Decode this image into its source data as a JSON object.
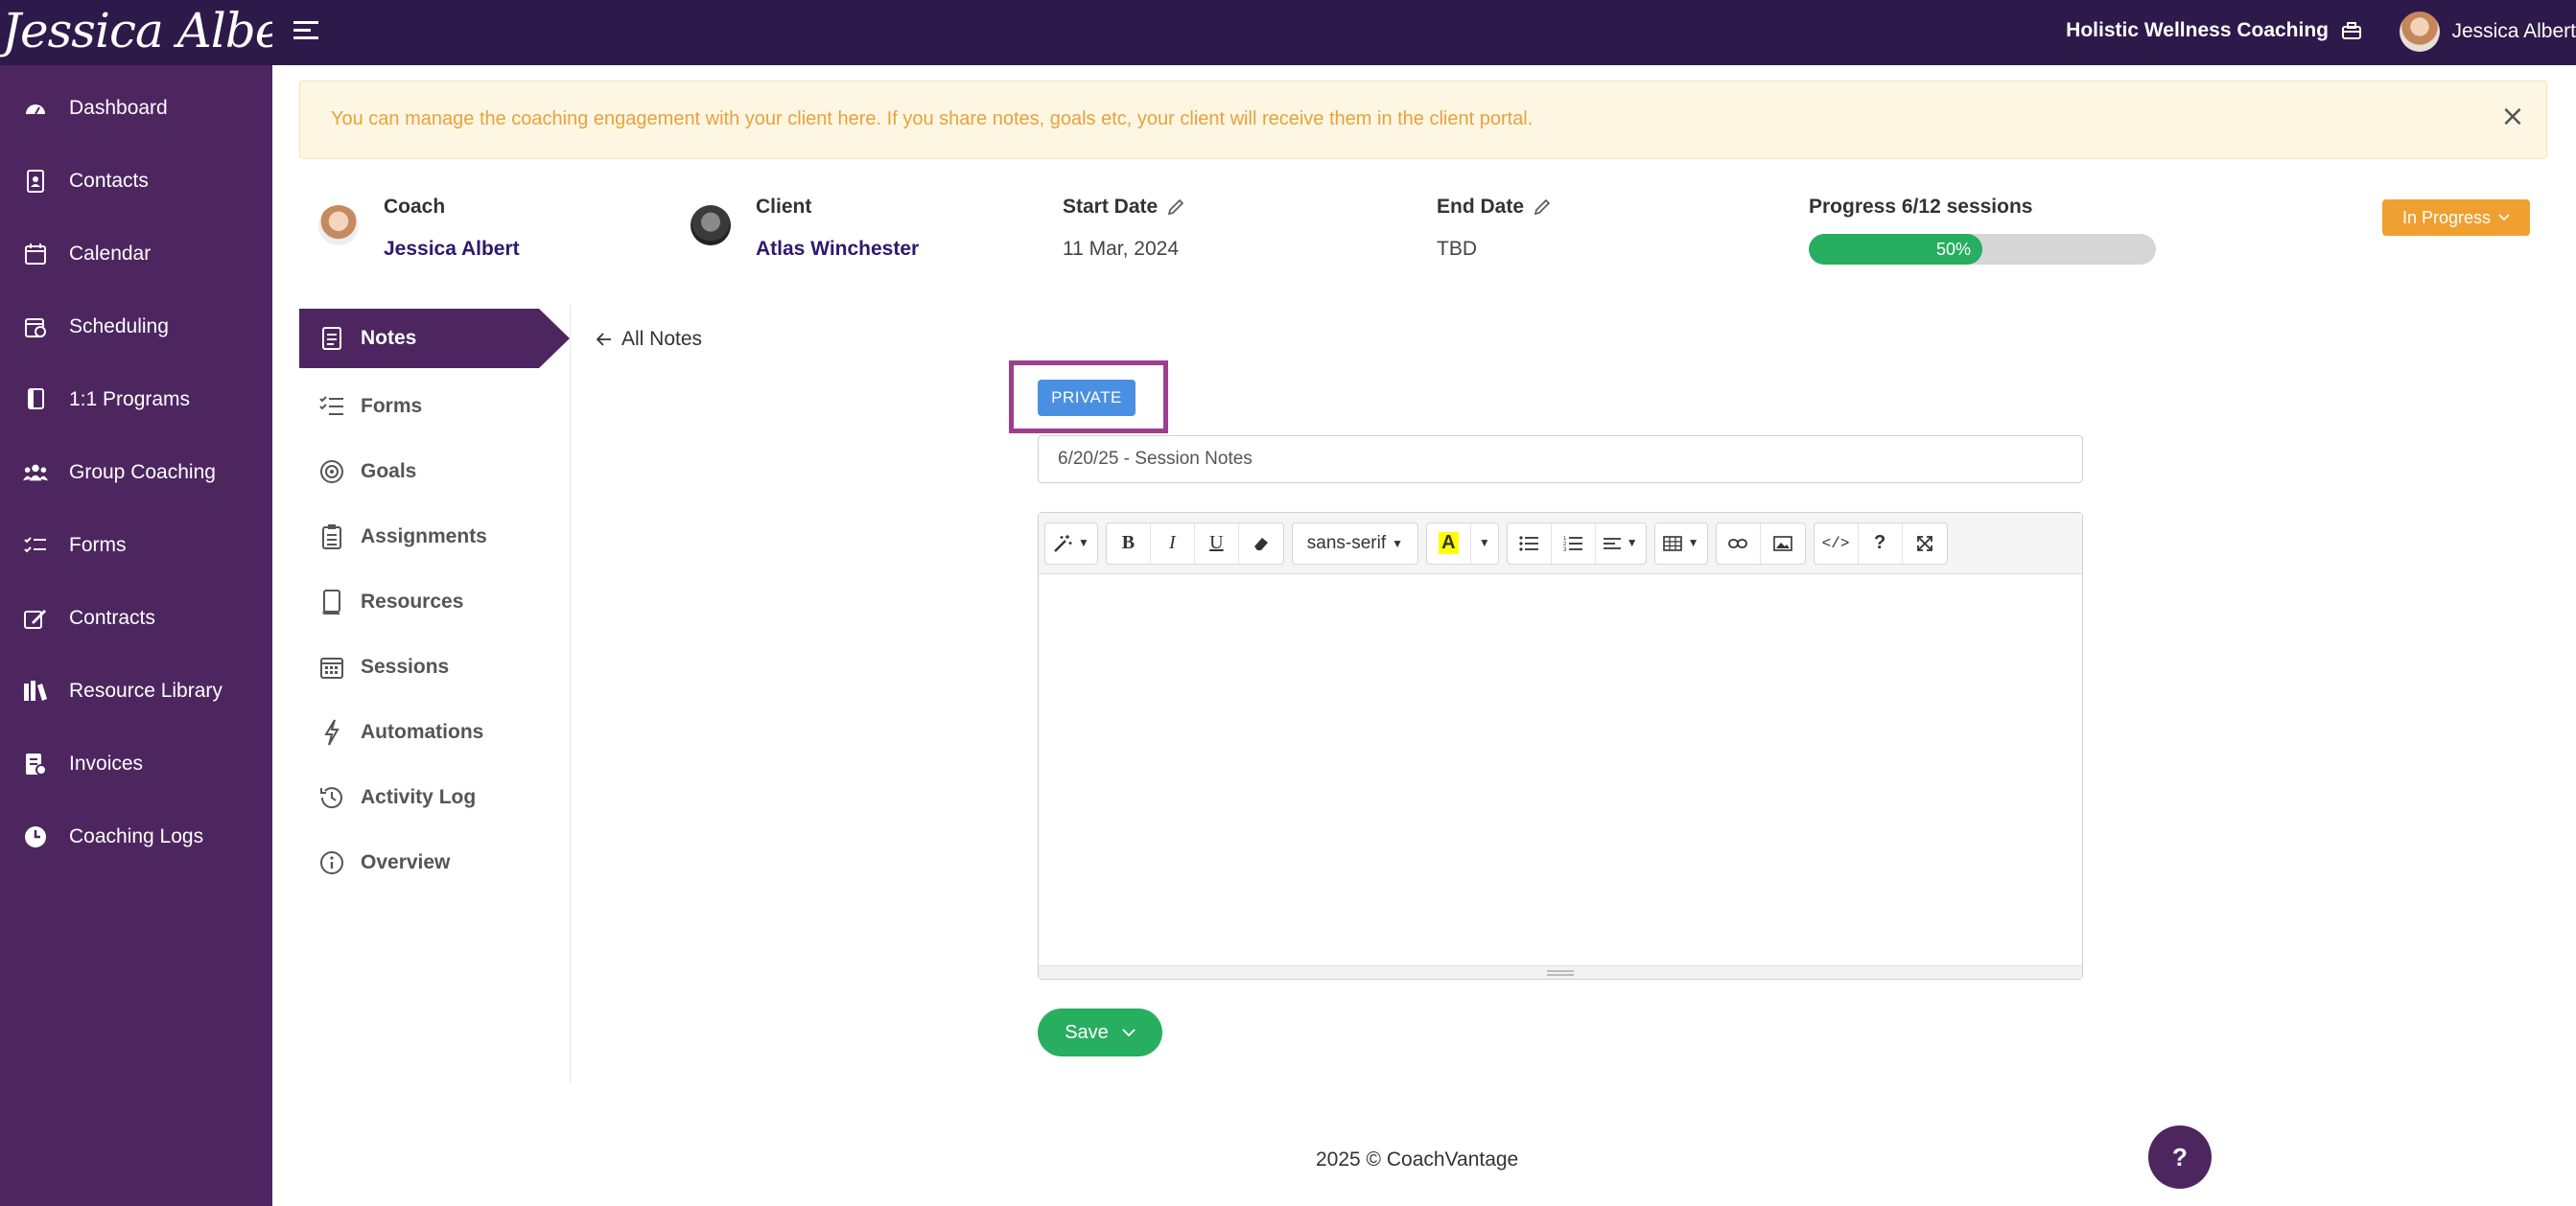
{
  "brand": {
    "logo_text": "Jessica Albert"
  },
  "header": {
    "org_name": "Holistic Wellness Coaching",
    "user_name": "Jessica Albert"
  },
  "sidebar": {
    "items": [
      {
        "label": "Dashboard",
        "icon": "dashboard-icon"
      },
      {
        "label": "Contacts",
        "icon": "contacts-icon"
      },
      {
        "label": "Calendar",
        "icon": "calendar-icon"
      },
      {
        "label": "Scheduling",
        "icon": "scheduling-icon"
      },
      {
        "label": "1:1 Programs",
        "icon": "programs-icon"
      },
      {
        "label": "Group Coaching",
        "icon": "group-icon"
      },
      {
        "label": "Forms",
        "icon": "forms-icon"
      },
      {
        "label": "Contracts",
        "icon": "contracts-icon"
      },
      {
        "label": "Resource Library",
        "icon": "library-icon"
      },
      {
        "label": "Invoices",
        "icon": "invoices-icon"
      },
      {
        "label": "Coaching Logs",
        "icon": "clock-icon"
      }
    ]
  },
  "alert": {
    "text": "You can manage the coaching engagement with your client here. If you share notes, goals etc, your client will receive them in the client portal.",
    "close": "×"
  },
  "engagement": {
    "coach_label": "Coach",
    "coach_name": "Jessica Albert",
    "client_label": "Client",
    "client_name": "Atlas Winchester",
    "start_label": "Start Date",
    "start_value": "11 Mar, 2024",
    "end_label": "End Date",
    "end_value": "TBD",
    "progress_label": "Progress 6/12 sessions",
    "progress_percent": 50,
    "progress_text": "50%",
    "status": "In Progress"
  },
  "subnav": {
    "items": [
      {
        "label": "Notes",
        "icon": "notes-icon",
        "active": true
      },
      {
        "label": "Forms",
        "icon": "forms-list-icon"
      },
      {
        "label": "Goals",
        "icon": "target-icon"
      },
      {
        "label": "Assignments",
        "icon": "clipboard-icon"
      },
      {
        "label": "Resources",
        "icon": "book-icon"
      },
      {
        "label": "Sessions",
        "icon": "calendar-grid-icon"
      },
      {
        "label": "Automations",
        "icon": "lightning-icon"
      },
      {
        "label": "Activity Log",
        "icon": "history-icon"
      },
      {
        "label": "Overview",
        "icon": "info-icon"
      }
    ]
  },
  "editor": {
    "back_label": "All Notes",
    "private_label": "PRIVATE",
    "title_value": "6/20/25 - Session Notes",
    "font_name": "sans-serif",
    "save_label": "Save"
  },
  "footer": {
    "text": "2025 © CoachVantage"
  },
  "help": {
    "label": "?"
  },
  "colors": {
    "topbar": "#2d1a4a",
    "sidebar": "#4d2660",
    "progress": "#27ae60",
    "status": "#f0a030",
    "private": "#4a90e2",
    "highlight": "#9b3f8e"
  }
}
